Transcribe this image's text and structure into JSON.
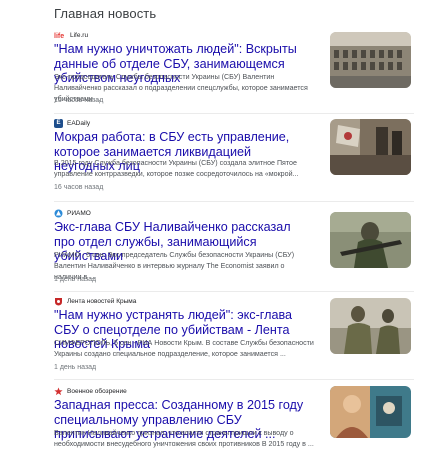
{
  "section_title": "Главная новость",
  "articles": [
    {
      "source": "Life.ru",
      "source_icon": "life-ru-logo-icon",
      "icon_color": "#e53935",
      "icon_glyph": "life",
      "title": "\"Нам нужно уничтожать людей\": Вскрыты данные об отделе СБУ, занимающемся убийством неугодных",
      "snippet": "Экс-председатель Службы безопасности Украины (СБУ) Валентин Наливайченко рассказал о подразделении спецслужбы, которое занимается убийствами ...",
      "time": "15 часов назад"
    },
    {
      "source": "EADaily",
      "source_icon": "eadaily-logo-icon",
      "icon_color": "#1e4e8c",
      "icon_glyph": "E",
      "title": "Мокрая работа: в СБУ есть управление, которое занимается ликвидацией неугодных лиц",
      "snippet": "В 2015 году Служба безопасности Украины (СБУ) создала элитное Пятое управление контрразведки, которое позже сосредоточилось на «мокрой...",
      "time": "16 часов назад"
    },
    {
      "source": "РИАМО",
      "source_icon": "riamo-logo-icon",
      "icon_color": "#2b8ad8",
      "icon_glyph": "",
      "title": "Экс-глава СБУ Наливайченко рассказал про отдел службы, занимающийся убийствами",
      "snippet": "РИАМО - 5 сен. Экс-председатель Службы безопасности Украины (СБУ) Валентин Наливайченко в интервью журналу The Economist заявил о наличии в ...",
      "time": "1 день назад"
    },
    {
      "source": "Лента новостей Крыма",
      "source_icon": "crimea-news-logo-icon",
      "icon_color": "#c62828",
      "icon_glyph": "",
      "title": "\"Нам нужно устранять людей\": экс-глава СБУ о спецотделе по убийствам - Лента новостей Крыма",
      "snippet": "СИМФЕРОПОЛЬ, 5 сен - РИА Новости Крым. В составе Службы безопасности Украины создано специальное подразделение, которое занимается ...",
      "time": "1 день назад"
    },
    {
      "source": "Военное обозрение",
      "source_icon": "military-review-logo-icon",
      "icon_color": "#ffffff",
      "icon_glyph": "★",
      "title": "Западная пресса: Созданному в 2015 году специальному управлению СБУ приписывают устранение деятелей ...",
      "snippet": "Валентин Наливайченко признал, что власти страны пришли к выводу о необходимости внесудебного уничтожения своих противников В 2015 году в ...",
      "time": ""
    }
  ]
}
